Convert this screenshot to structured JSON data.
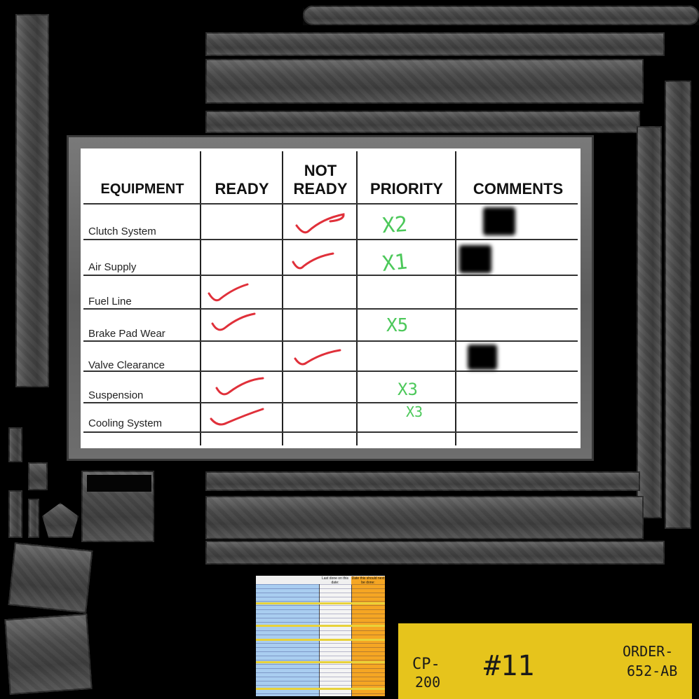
{
  "board": {
    "headers": {
      "equipment": "EQUIPMENT",
      "ready": "READY",
      "not_ready_1": "NOT",
      "not_ready_2": "READY",
      "priority": "PRIORITY",
      "comments": "COMMENTS"
    },
    "rows": [
      {
        "label": "Clutch System",
        "status": "not_ready",
        "priority": "X2",
        "comment_mark": true
      },
      {
        "label": "Air Supply",
        "status": "not_ready",
        "priority": "X1",
        "comment_mark": true
      },
      {
        "label": "Fuel Line",
        "status": "ready",
        "priority": "",
        "comment_mark": false
      },
      {
        "label": "Brake Pad Wear",
        "status": "ready",
        "priority": "X5",
        "comment_mark": false
      },
      {
        "label": "Valve Clearance",
        "status": "not_ready",
        "priority": "",
        "comment_mark": true
      },
      {
        "label": "Suspension",
        "status": "ready",
        "priority": "X3",
        "comment_mark": false
      },
      {
        "label": "Cooling System",
        "status": "ready",
        "priority": "X3",
        "comment_mark": false
      }
    ],
    "check_color": "#e0303a",
    "priority_color": "#4cc85a"
  },
  "mini_sheet": {
    "col2_header": "Last done on this date:",
    "col3_header": "Date this should next be done:"
  },
  "tag": {
    "code_1": "CP-",
    "code_2": "200",
    "number": "#11",
    "order_1": "ORDER-",
    "order_2": "652-AB",
    "color": "#e6c41c"
  }
}
